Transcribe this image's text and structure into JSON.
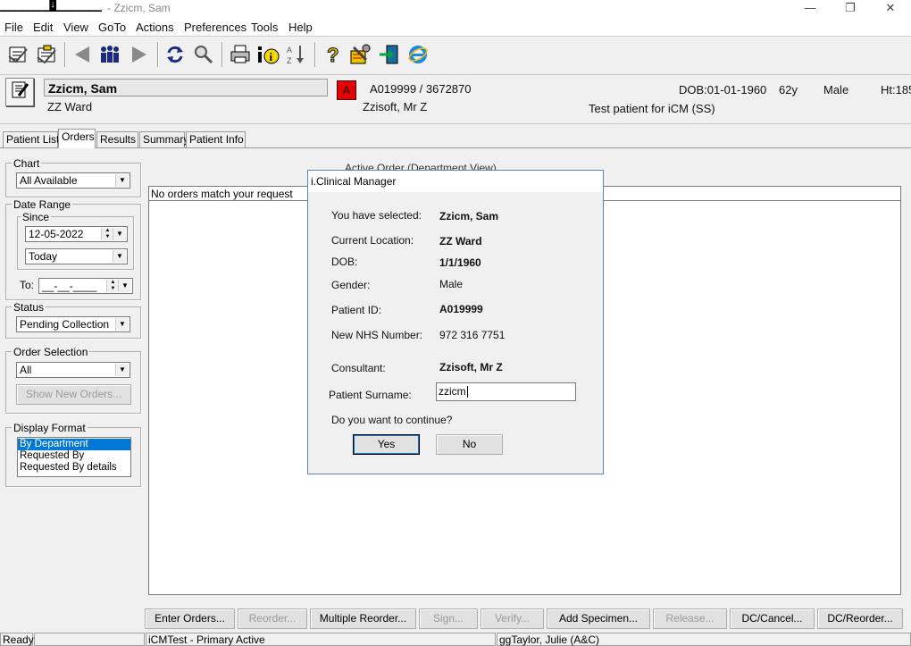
{
  "window": {
    "title_prefix": "████████ ↓ ████████",
    "title": "- Zzicm, Sam",
    "min": "—",
    "max": "❐",
    "close": "✕"
  },
  "menu": [
    "File",
    "Edit",
    "View",
    "GoTo",
    "Actions",
    "Preferences",
    "Tools",
    "Help"
  ],
  "toolbar": {
    "icons": [
      "patient-list-icon",
      "patient-folder-icon",
      "back-arrow-icon",
      "people-icon",
      "forward-arrow-icon",
      "refresh-icon",
      "find-icon",
      "print-icon",
      "info-icon",
      "sort-icon",
      "help-icon",
      "tools-icon",
      "exit-icon",
      "internet-explorer-icon"
    ]
  },
  "patient": {
    "name": "Zzicm, Sam",
    "ward": "ZZ Ward",
    "alert": "A",
    "ids": "A019999 / 3672870",
    "consultant": "Zzisoft, Mr Z",
    "dob": "DOB:01-01-1960",
    "age": "62y",
    "gender": "Male",
    "height": "Ht:185",
    "note": "Test patient for iCM (SS)"
  },
  "tabs": [
    "Patient List",
    "Orders",
    "Results",
    "Summary",
    "Patient Info"
  ],
  "active_tab": "Orders",
  "left": {
    "chart": {
      "label": "Chart",
      "value": "All Available"
    },
    "date_range": {
      "label": "Date Range",
      "since_label": "Since",
      "since_date": "12-05-2022",
      "since_preset": "Today",
      "to_label": "To:",
      "to_value": "__-__-____"
    },
    "status": {
      "label": "Status",
      "value": "Pending Collection"
    },
    "order_selection": {
      "label": "Order Selection",
      "value": "All",
      "show_new": "Show New Orders..."
    },
    "display_format": {
      "label": "Display Format",
      "options": [
        "By Department",
        "Requested By",
        "Requested By details"
      ],
      "selected": "By Department"
    }
  },
  "main": {
    "title": "Active Order (Department View)",
    "empty_message": "No orders match your request"
  },
  "bottom_buttons": [
    {
      "label": "Enter Orders...",
      "enabled": true
    },
    {
      "label": "Reorder...",
      "enabled": false
    },
    {
      "label": "Multiple Reorder...",
      "enabled": true
    },
    {
      "label": "Sign...",
      "enabled": false
    },
    {
      "label": "Verify...",
      "enabled": false
    },
    {
      "label": "Add Specimen...",
      "enabled": true
    },
    {
      "label": "Release...",
      "enabled": false
    },
    {
      "label": "DC/Cancel...",
      "enabled": true
    },
    {
      "label": "DC/Reorder...",
      "enabled": true
    }
  ],
  "status_bar": {
    "ready": "Ready",
    "env": "iCMTest - Primary Active",
    "user": "ggTaylor, Julie  (A&C)"
  },
  "dialog": {
    "title": "i.Clinical Manager",
    "fields": [
      {
        "label": "You have selected:",
        "value": "Zzicm, Sam",
        "bold": true
      },
      {
        "label": "Current Location:",
        "value": "ZZ Ward",
        "bold": true
      },
      {
        "label": "DOB:",
        "value": "1/1/1960",
        "bold": true
      },
      {
        "label": "Gender:",
        "value": "Male",
        "bold": false
      },
      {
        "label": "Patient ID:",
        "value": "A019999",
        "bold": true
      },
      {
        "label": "New NHS Number:",
        "value": "972 316 7751",
        "bold": false
      },
      {
        "label": "Consultant:",
        "value": "Zzisoft, Mr Z",
        "bold": true
      }
    ],
    "surname_label": "Patient Surname:",
    "surname_value": "zzicm",
    "question": "Do you want to continue?",
    "yes": "Yes",
    "no": "No"
  }
}
